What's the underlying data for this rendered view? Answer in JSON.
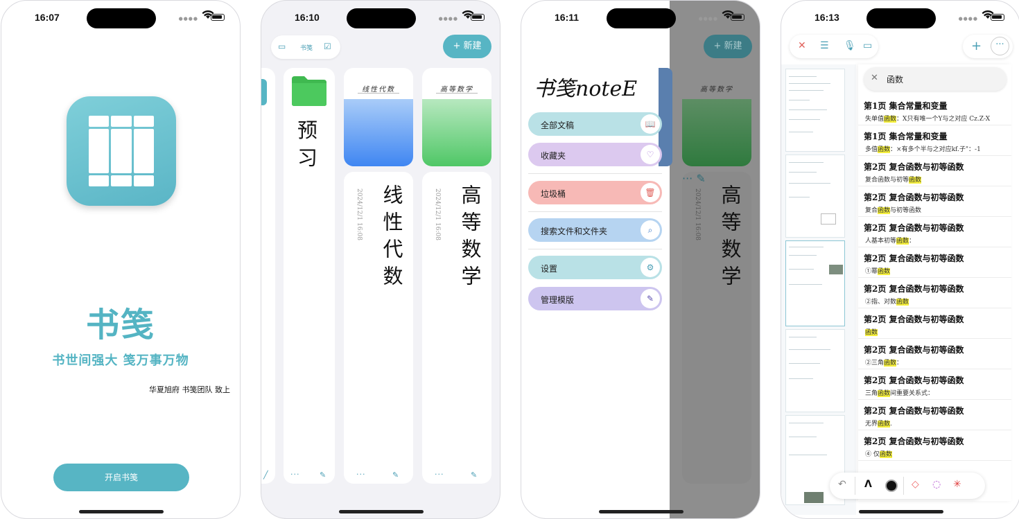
{
  "phone1": {
    "status": {
      "time": "16:07"
    },
    "brand_title": "书笺",
    "brand_subtitle": "书世间强大 笺万事万物",
    "brand_sign": "华夏旭府 书笺团队 致上",
    "open_button": "开启书笺"
  },
  "phone2": {
    "status": {
      "time": "16:10"
    },
    "toolbar": {
      "label": "书笺"
    },
    "new_button": "+ 新建",
    "folder": {
      "title": "预习"
    },
    "notebooks": [
      {
        "cover_text": "线性代数",
        "title": "线性代数",
        "date": "2024/12/1 16:08",
        "cover_color": "#3f86f2"
      },
      {
        "cover_text": "高等数学",
        "title": "高等数学",
        "date": "2024/12/1 16:08",
        "cover_color": "#4fc766"
      }
    ],
    "card_menu": "···",
    "card_edit": "✎"
  },
  "phone3": {
    "status": {
      "time": "16:11"
    },
    "logo": "书笺noteE",
    "new_button": "+ 新建",
    "menu": [
      {
        "label": "全部文稿",
        "icon": "book-icon",
        "color": "#b9e1e6"
      },
      {
        "label": "收藏夹",
        "icon": "heart-icon",
        "color": "#dcc9ef"
      },
      {
        "label": "垃圾桶",
        "icon": "trash-icon",
        "color": "#f7b9b6"
      },
      {
        "label": "搜索文件和文件夹",
        "icon": "search-icon",
        "color": "#b6d4f1"
      },
      {
        "label": "设置",
        "icon": "gear-icon",
        "color": "#b9e1e6"
      },
      {
        "label": "管理模版",
        "icon": "pencil-icon",
        "color": "#cdc5ef"
      }
    ],
    "bg_title": "高等数学",
    "bg_cover_text": "高等数学",
    "card_menu": "···",
    "card_edit": "✎"
  },
  "phone4": {
    "status": {
      "time": "16:13"
    },
    "search_query": "函数",
    "results": [
      {
        "title": "第1页  集合常量和变量",
        "pre": "失单值",
        "hit": "函数",
        "post": "：X只有唯一个Y与之对应 Cz.Z-X"
      },
      {
        "title": "第1页  集合常量和变量",
        "pre": "多值",
        "hit": "函数",
        "post": "：×有多个半与之对应kf.子\"：-1"
      },
      {
        "title": "第2页  复合函数与初等函数",
        "pre": "复合函数与初等",
        "hit": "函数",
        "post": ""
      },
      {
        "title": "第2页  复合函数与初等函数",
        "pre": "复合",
        "hit": "函数",
        "post": "与初等函数"
      },
      {
        "title": "第2页  复合函数与初等函数",
        "pre": "人基本初等",
        "hit": "函数",
        "post": "："
      },
      {
        "title": "第2页  复合函数与初等函数",
        "pre": "①幂",
        "hit": "函数",
        "post": ""
      },
      {
        "title": "第2页  复合函数与初等函数",
        "pre": "②指、对数",
        "hit": "函数",
        "post": ""
      },
      {
        "title": "第2页  复合函数与初等函数",
        "pre": "",
        "hit": "函数",
        "post": ""
      },
      {
        "title": "第2页  复合函数与初等函数",
        "pre": "②三角",
        "hit": "函数",
        "post": "："
      },
      {
        "title": "第2页  复合函数与初等函数",
        "pre": "三角",
        "hit": "函数",
        "post": "间重要关系式："
      },
      {
        "title": "第2页  复合函数与初等函数",
        "pre": "无界",
        "hit": "函数",
        "post": "."
      },
      {
        "title": "第2页  复合函数与初等函数",
        "pre": "④ 仅",
        "hit": "函数",
        "post": ""
      }
    ]
  },
  "colors": {
    "accent": "#57b5c4",
    "highlight": "#f5ef3c"
  }
}
